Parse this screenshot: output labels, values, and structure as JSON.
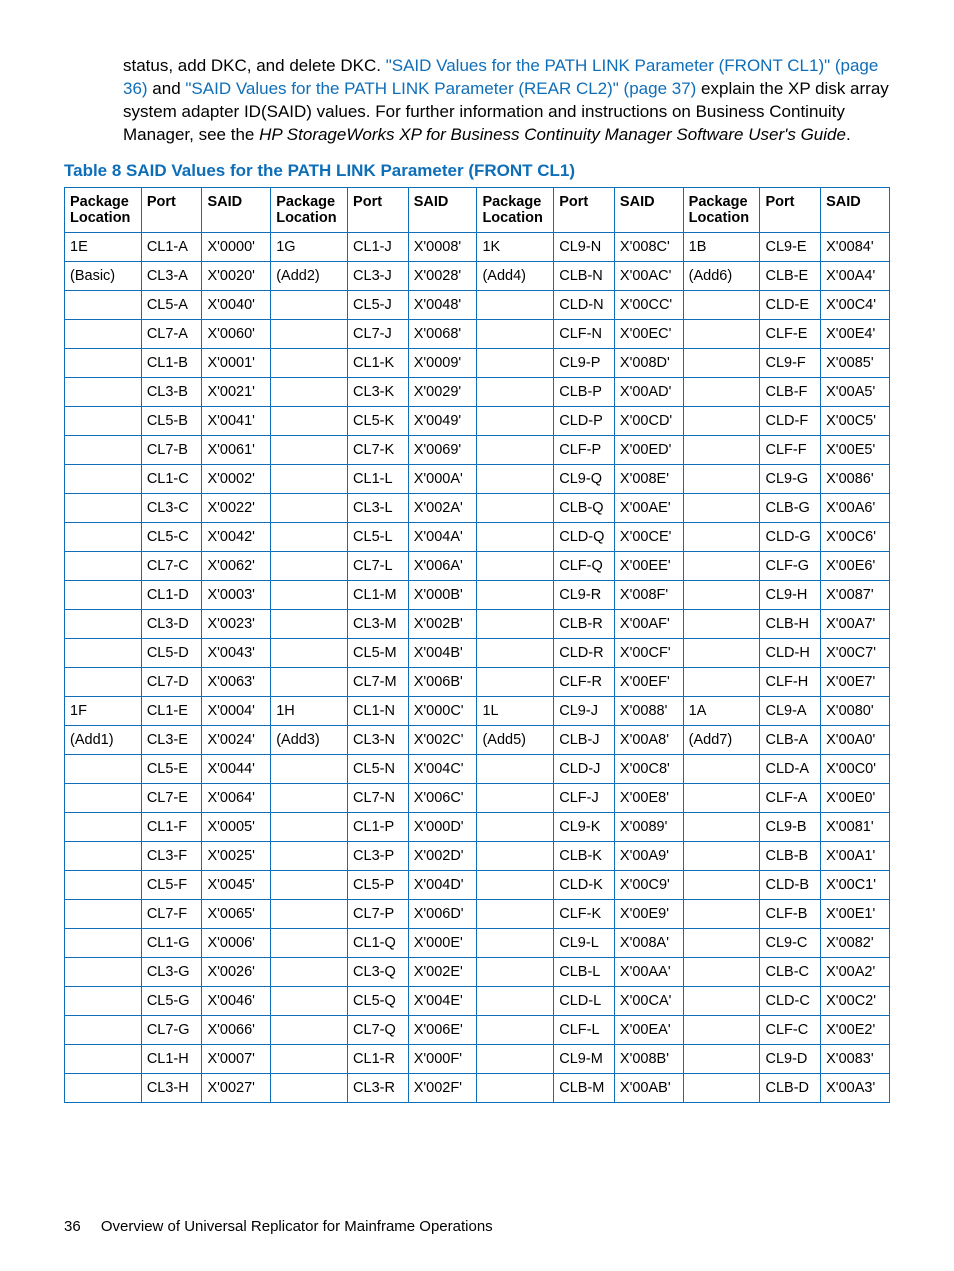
{
  "intro": {
    "pre": "status, add DKC, and delete DKC. ",
    "link1": "\"SAID Values for the PATH LINK Parameter (FRONT CL1)\" (page 36)",
    "mid1": " and ",
    "link2": "\"SAID Values for the PATH LINK Parameter (REAR CL2)\" (page 37)",
    "post1": " explain the XP disk array system adapter ID(SAID) values. For further information and instructions on Business Continuity Manager, see the ",
    "italic": "HP StorageWorks XP for Business Continuity Manager Software User's Guide",
    "post2": "."
  },
  "table_caption": "Table 8 SAID Values for the PATH LINK Parameter (FRONT CL1)",
  "headers": [
    "Package Location",
    "Port",
    "SAID",
    "Package Location",
    "Port",
    "SAID",
    "Package Location",
    "Port",
    "SAID",
    "Package Location",
    "Port",
    "SAID"
  ],
  "rows": [
    [
      "1E",
      "CL1-A",
      "X'0000'",
      "1G",
      "CL1-J",
      "X'0008'",
      "1K",
      "CL9-N",
      "X'008C'",
      "1B",
      "CL9-E",
      "X'0084'"
    ],
    [
      "(Basic)",
      "CL3-A",
      "X'0020'",
      "(Add2)",
      "CL3-J",
      "X'0028'",
      "(Add4)",
      "CLB-N",
      "X'00AC'",
      "(Add6)",
      "CLB-E",
      "X'00A4'"
    ],
    [
      "",
      "CL5-A",
      "X'0040'",
      "",
      "CL5-J",
      "X'0048'",
      "",
      "CLD-N",
      "X'00CC'",
      "",
      "CLD-E",
      "X'00C4'"
    ],
    [
      "",
      "CL7-A",
      "X'0060'",
      "",
      "CL7-J",
      "X'0068'",
      "",
      "CLF-N",
      "X'00EC'",
      "",
      "CLF-E",
      "X'00E4'"
    ],
    [
      "",
      "CL1-B",
      "X'0001'",
      "",
      "CL1-K",
      "X'0009'",
      "",
      "CL9-P",
      "X'008D'",
      "",
      "CL9-F",
      "X'0085'"
    ],
    [
      "",
      "CL3-B",
      "X'0021'",
      "",
      "CL3-K",
      "X'0029'",
      "",
      "CLB-P",
      "X'00AD'",
      "",
      "CLB-F",
      "X'00A5'"
    ],
    [
      "",
      "CL5-B",
      "X'0041'",
      "",
      "CL5-K",
      "X'0049'",
      "",
      "CLD-P",
      "X'00CD'",
      "",
      "CLD-F",
      "X'00C5'"
    ],
    [
      "",
      "CL7-B",
      "X'0061'",
      "",
      "CL7-K",
      "X'0069'",
      "",
      "CLF-P",
      "X'00ED'",
      "",
      "CLF-F",
      "X'00E5'"
    ],
    [
      "",
      "CL1-C",
      "X'0002'",
      "",
      "CL1-L",
      "X'000A'",
      "",
      "CL9-Q",
      "X'008E'",
      "",
      "CL9-G",
      "X'0086'"
    ],
    [
      "",
      "CL3-C",
      "X'0022'",
      "",
      "CL3-L",
      "X'002A'",
      "",
      "CLB-Q",
      "X'00AE'",
      "",
      "CLB-G",
      "X'00A6'"
    ],
    [
      "",
      "CL5-C",
      "X'0042'",
      "",
      "CL5-L",
      "X'004A'",
      "",
      "CLD-Q",
      "X'00CE'",
      "",
      "CLD-G",
      "X'00C6'"
    ],
    [
      "",
      "CL7-C",
      "X'0062'",
      "",
      "CL7-L",
      "X'006A'",
      "",
      "CLF-Q",
      "X'00EE'",
      "",
      "CLF-G",
      "X'00E6'"
    ],
    [
      "",
      "CL1-D",
      "X'0003'",
      "",
      "CL1-M",
      "X'000B'",
      "",
      "CL9-R",
      "X'008F'",
      "",
      "CL9-H",
      "X'0087'"
    ],
    [
      "",
      "CL3-D",
      "X'0023'",
      "",
      "CL3-M",
      "X'002B'",
      "",
      "CLB-R",
      "X'00AF'",
      "",
      "CLB-H",
      "X'00A7'"
    ],
    [
      "",
      "CL5-D",
      "X'0043'",
      "",
      "CL5-M",
      "X'004B'",
      "",
      "CLD-R",
      "X'00CF'",
      "",
      "CLD-H",
      "X'00C7'"
    ],
    [
      "",
      "CL7-D",
      "X'0063'",
      "",
      "CL7-M",
      "X'006B'",
      "",
      "CLF-R",
      "X'00EF'",
      "",
      "CLF-H",
      "X'00E7'"
    ],
    [
      "1F",
      "CL1-E",
      "X'0004'",
      "1H",
      "CL1-N",
      "X'000C'",
      "1L",
      "CL9-J",
      "X'0088'",
      "1A",
      "CL9-A",
      "X'0080'"
    ],
    [
      "(Add1)",
      "CL3-E",
      "X'0024'",
      "(Add3)",
      "CL3-N",
      "X'002C'",
      "(Add5)",
      "CLB-J",
      "X'00A8'",
      "(Add7)",
      "CLB-A",
      "X'00A0'"
    ],
    [
      "",
      "CL5-E",
      "X'0044'",
      "",
      "CL5-N",
      "X'004C'",
      "",
      "CLD-J",
      "X'00C8'",
      "",
      "CLD-A",
      "X'00C0'"
    ],
    [
      "",
      "CL7-E",
      "X'0064'",
      "",
      "CL7-N",
      "X'006C'",
      "",
      "CLF-J",
      "X'00E8'",
      "",
      "CLF-A",
      "X'00E0'"
    ],
    [
      "",
      "CL1-F",
      "X'0005'",
      "",
      "CL1-P",
      "X'000D'",
      "",
      "CL9-K",
      "X'0089'",
      "",
      "CL9-B",
      "X'0081'"
    ],
    [
      "",
      "CL3-F",
      "X'0025'",
      "",
      "CL3-P",
      "X'002D'",
      "",
      "CLB-K",
      "X'00A9'",
      "",
      "CLB-B",
      "X'00A1'"
    ],
    [
      "",
      "CL5-F",
      "X'0045'",
      "",
      "CL5-P",
      "X'004D'",
      "",
      "CLD-K",
      "X'00C9'",
      "",
      "CLD-B",
      "X'00C1'"
    ],
    [
      "",
      "CL7-F",
      "X'0065'",
      "",
      "CL7-P",
      "X'006D'",
      "",
      "CLF-K",
      "X'00E9'",
      "",
      "CLF-B",
      "X'00E1'"
    ],
    [
      "",
      "CL1-G",
      "X'0006'",
      "",
      "CL1-Q",
      "X'000E'",
      "",
      "CL9-L",
      "X'008A'",
      "",
      "CL9-C",
      "X'0082'"
    ],
    [
      "",
      "CL3-G",
      "X'0026'",
      "",
      "CL3-Q",
      "X'002E'",
      "",
      "CLB-L",
      "X'00AA'",
      "",
      "CLB-C",
      "X'00A2'"
    ],
    [
      "",
      "CL5-G",
      "X'0046'",
      "",
      "CL5-Q",
      "X'004E'",
      "",
      "CLD-L",
      "X'00CA'",
      "",
      "CLD-C",
      "X'00C2'"
    ],
    [
      "",
      "CL7-G",
      "X'0066'",
      "",
      "CL7-Q",
      "X'006E'",
      "",
      "CLF-L",
      "X'00EA'",
      "",
      "CLF-C",
      "X'00E2'"
    ],
    [
      "",
      "CL1-H",
      "X'0007'",
      "",
      "CL1-R",
      "X'000F'",
      "",
      "CL9-M",
      "X'008B'",
      "",
      "CL9-D",
      "X'0083'"
    ],
    [
      "",
      "CL3-H",
      "X'0027'",
      "",
      "CL3-R",
      "X'002F'",
      "",
      "CLB-M",
      "X'00AB'",
      "",
      "CLB-D",
      "X'00A3'"
    ]
  ],
  "footer": {
    "page_number": "36",
    "section": "Overview of Universal Replicator for Mainframe Operations"
  }
}
